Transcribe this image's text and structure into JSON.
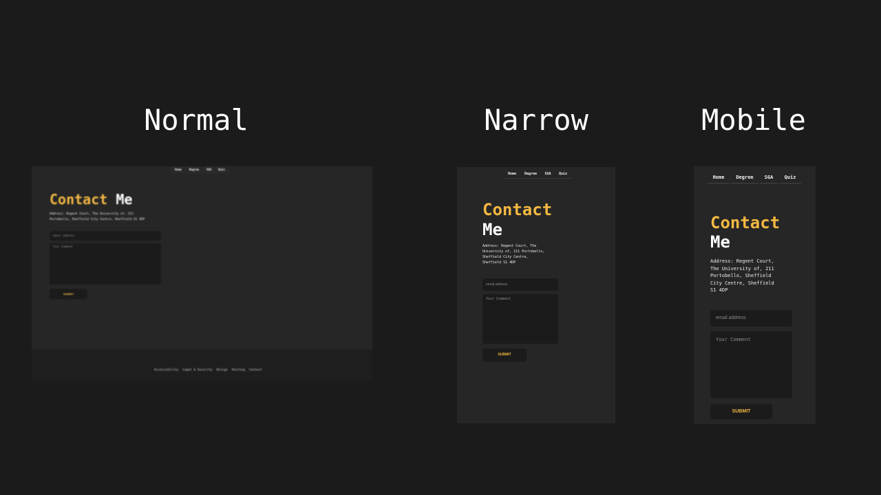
{
  "captions": {
    "normal": "Normal",
    "narrow": "Narrow",
    "mobile": "Mobile"
  },
  "nav": {
    "home": "Home",
    "degree": "Degree",
    "sga": "SGA",
    "quiz": "Quiz"
  },
  "heading": {
    "accent": "Contact",
    "rest": "Me"
  },
  "address": {
    "normal_line1": "Address: Regent Court, The University of, 211",
    "normal_line2": "Portobello, Sheffield City Centre, Sheffield S1 4DP",
    "narrow_lines": [
      "Address: Regent Court, The",
      "University of, 211 Portobello,",
      "Sheffield City Centre,",
      "Sheffield S1 4DP"
    ],
    "mobile_lines": [
      "Address: Regent Court,",
      "The University of, 211",
      "Portobello, Sheffield",
      "City Centre, Sheffield",
      "S1 4DP"
    ]
  },
  "form": {
    "email_placeholder": "email address",
    "comment_placeholder": "Your Comment",
    "submit_label": "SUBMIT"
  },
  "footer": {
    "links": [
      "Accessibility",
      "Legal & Security",
      "Design",
      "Hosting",
      "Contact"
    ]
  },
  "colors": {
    "background": "#1b1b1b",
    "panel": "#262626",
    "accent": "#f2b842"
  }
}
